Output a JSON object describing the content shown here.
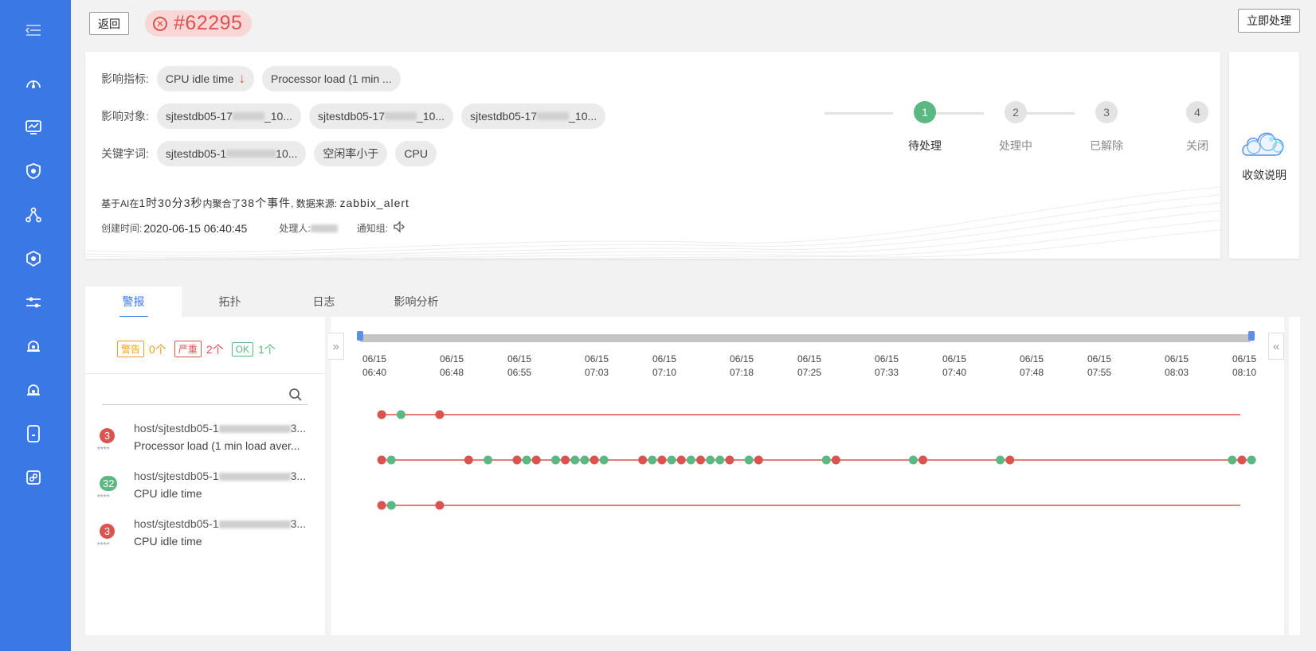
{
  "header": {
    "back_label": "返回",
    "incident_number": "#62295",
    "handle_now_label": "立即处理"
  },
  "info": {
    "impact_metrics_label": "影响指标:",
    "impact_metrics": [
      "CPU idle time",
      "Processor load (1 min ..."
    ],
    "impact_objects_label": "影响对象:",
    "impact_objects": [
      {
        "pre": "sjtestdb05-17",
        "post": "_10..."
      },
      {
        "pre": "sjtestdb05-17",
        "post": "_10..."
      },
      {
        "pre": "sjtestdb05-17",
        "post": "_10..."
      }
    ],
    "keywords_label": "关键字词:",
    "keyword_host": {
      "pre": "sjtestdb05-1",
      "post": "10..."
    },
    "keywords": [
      "空闲率小于",
      "CPU"
    ],
    "summary_prefix": "基于AI在",
    "summary_duration": "1时30分3秒",
    "summary_mid": "内聚合了",
    "summary_count": "38个事件",
    "summary_source_label": ", 数据来源:",
    "summary_source": "zabbix_alert",
    "created_label": "创建时间:",
    "created_value": "2020-06-15 06:40:45",
    "handler_label": "处理人:",
    "notify_label": "通知组:"
  },
  "steps": [
    {
      "num": "1",
      "label": "待处理",
      "active": true
    },
    {
      "num": "2",
      "label": "处理中",
      "active": false
    },
    {
      "num": "3",
      "label": "已解除",
      "active": false
    },
    {
      "num": "4",
      "label": "关闭",
      "active": false
    }
  ],
  "convergence_label": "收敛说明",
  "tabs": [
    "警报",
    "拓扑",
    "日志",
    "影响分析"
  ],
  "counts": {
    "warn_label": "警告",
    "warn_count": "0个",
    "crit_label": "严重",
    "crit_count": "2个",
    "ok_label": "OK",
    "ok_count": "1个"
  },
  "alerts": [
    {
      "badge": "3",
      "badge_color": "#d9534f",
      "host_pre": "host/sjtestdb05-1",
      "host_post": "3...",
      "metric": "Processor load (1 min load aver...",
      "stars": "****"
    },
    {
      "badge": "32",
      "badge_color": "#5cb883",
      "host_pre": "host/sjtestdb05-1",
      "host_post": "3...",
      "metric": "CPU idle time",
      "stars": "****"
    },
    {
      "badge": "3",
      "badge_color": "#d9534f",
      "host_pre": "host/sjtestdb05-1",
      "host_post": "3...",
      "metric": "CPU idle time",
      "stars": "****"
    }
  ],
  "timeline": {
    "dates": [
      "06/15",
      "06/15",
      "06/15",
      "06/15",
      "06/15",
      "06/15",
      "06/15",
      "06/15",
      "06/15",
      "06/15",
      "06/15",
      "06/15",
      "06/15"
    ],
    "times": [
      "06:40",
      "06:48",
      "06:55",
      "07:03",
      "07:10",
      "07:18",
      "07:25",
      "07:33",
      "07:40",
      "07:48",
      "07:55",
      "08:03",
      "08:10"
    ],
    "colors": {
      "critical": "#d9534f",
      "ok": "#5cb883"
    },
    "events": [
      [
        "06:40:45",
        "critical"
      ],
      [
        "06:42:45",
        "ok"
      ],
      [
        "06:46:45",
        "critical"
      ]
    ],
    "rows": [
      {
        "events": [
          [
            "06:40:45",
            "c"
          ],
          [
            "06:42:45",
            "o"
          ],
          [
            "06:46:45",
            "c"
          ]
        ],
        "open_until": "08:09:35"
      },
      {
        "events": [
          [
            "06:40:45",
            "c"
          ],
          [
            "06:41:45",
            "o"
          ],
          [
            "06:49:45",
            "c"
          ],
          [
            "06:51:45",
            "o"
          ],
          [
            "06:54:45",
            "c"
          ],
          [
            "06:55:45",
            "o"
          ],
          [
            "06:56:45",
            "c"
          ],
          [
            "06:58:45",
            "o"
          ],
          [
            "06:59:45",
            "c"
          ],
          [
            "07:00:45",
            "o"
          ],
          [
            "07:01:45",
            "o"
          ],
          [
            "07:02:45",
            "c"
          ],
          [
            "07:03:45",
            "o"
          ],
          [
            "07:07:45",
            "c"
          ],
          [
            "07:08:45",
            "o"
          ],
          [
            "07:09:45",
            "c"
          ],
          [
            "07:10:45",
            "o"
          ],
          [
            "07:11:45",
            "c"
          ],
          [
            "07:12:45",
            "o"
          ],
          [
            "07:13:45",
            "c"
          ],
          [
            "07:14:45",
            "o"
          ],
          [
            "07:15:45",
            "o"
          ],
          [
            "07:16:45",
            "c"
          ],
          [
            "07:18:45",
            "o"
          ],
          [
            "07:19:45",
            "c"
          ],
          [
            "07:26:45",
            "o"
          ],
          [
            "07:27:45",
            "c"
          ],
          [
            "07:35:45",
            "o"
          ],
          [
            "07:36:45",
            "c"
          ],
          [
            "07:44:45",
            "o"
          ],
          [
            "07:45:45",
            "c"
          ],
          [
            "08:08:45",
            "o"
          ],
          [
            "08:09:45",
            "c"
          ],
          [
            "08:10:45",
            "o"
          ]
        ]
      },
      {
        "events": [
          [
            "06:40:45",
            "c"
          ],
          [
            "06:41:45",
            "o"
          ],
          [
            "06:46:45",
            "c"
          ]
        ],
        "open_until": "08:09:35"
      }
    ]
  }
}
